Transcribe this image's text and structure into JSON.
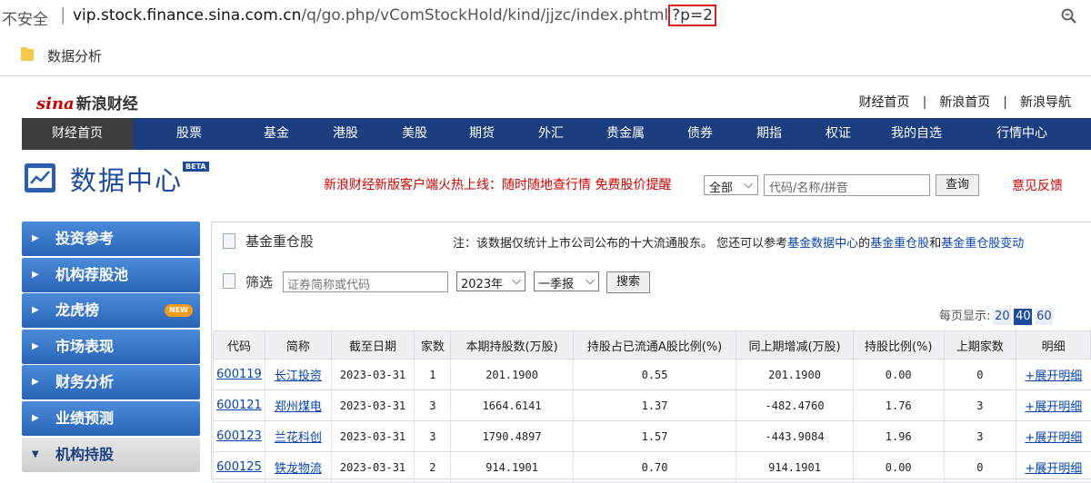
{
  "browser": {
    "insecure_label": "不安全",
    "url_host": "vip.stock.finance.sina.com.cn",
    "url_path": "/q/go.php/vComStockHold/kind/jjzc/index.phtml",
    "url_query": "?p=2",
    "bookmark": "数据分析"
  },
  "header": {
    "logo_text": "sina",
    "logo_cn": "新浪财经",
    "links": [
      "财经首页",
      "新浪首页",
      "新浪导航"
    ]
  },
  "nav": [
    "财经首页",
    "股票",
    "基金",
    "港股",
    "美股",
    "期货",
    "外汇",
    "贵金属",
    "债券",
    "期指",
    "权证",
    "我的自选",
    "行情中心"
  ],
  "banner": {
    "title": "数据中心",
    "beta": "BETA",
    "promo": "新浪财经新版客户端火热上线：随时随地查行情 免费股价提醒",
    "scope": "全部",
    "search_placeholder": "代码/名称/拼音",
    "search_btn": "查询",
    "feedback": "意见反馈"
  },
  "sidebar": [
    {
      "label": "投资参考",
      "new": ""
    },
    {
      "label": "机构荐股池",
      "new": ""
    },
    {
      "label": "龙虎榜",
      "new": "NEW"
    },
    {
      "label": "市场表现",
      "new": ""
    },
    {
      "label": "财务分析",
      "new": ""
    },
    {
      "label": "业绩预测",
      "new": ""
    },
    {
      "label": "机构持股",
      "new": ""
    }
  ],
  "panel": {
    "title": "基金重仓股",
    "note_prefix": "注：该数据仅统计上市公司公布的十大流通股东。 您还可以参考",
    "note_link1": "基金数据中心",
    "note_mid": "的",
    "note_link2": "基金重仓股",
    "note_and": "和",
    "note_link3": "基金重仓股变动",
    "filter_label": "筛选",
    "filter_placeholder": "证券简称或代码",
    "year": "2023年",
    "quarter": "一季报",
    "search_btn": "搜索",
    "per_page_label": "每页显示:",
    "per_page": [
      "20",
      "40",
      "60"
    ],
    "per_page_selected": "40"
  },
  "table": {
    "headers": [
      "代码",
      "简称",
      "截至日期",
      "家数",
      "本期持股数(万股)",
      "持股占已流通A股比例(%)",
      "同上期增减(万股)",
      "持股比例(%)",
      "上期家数",
      "明细"
    ],
    "rows": [
      [
        "600119",
        "长江投资",
        "2023-03-31",
        "1",
        "201.1900",
        "0.55",
        "201.1900",
        "0.00",
        "0",
        "+展开明细"
      ],
      [
        "600121",
        "郑州煤电",
        "2023-03-31",
        "3",
        "1664.6141",
        "1.37",
        "-482.4760",
        "1.76",
        "3",
        "+展开明细"
      ],
      [
        "600123",
        "兰花科创",
        "2023-03-31",
        "3",
        "1790.4897",
        "1.57",
        "-443.9084",
        "1.96",
        "3",
        "+展开明细"
      ],
      [
        "600125",
        "铁龙物流",
        "2023-03-31",
        "2",
        "914.1901",
        "0.70",
        "914.1901",
        "0.00",
        "0",
        "+展开明细"
      ]
    ]
  }
}
